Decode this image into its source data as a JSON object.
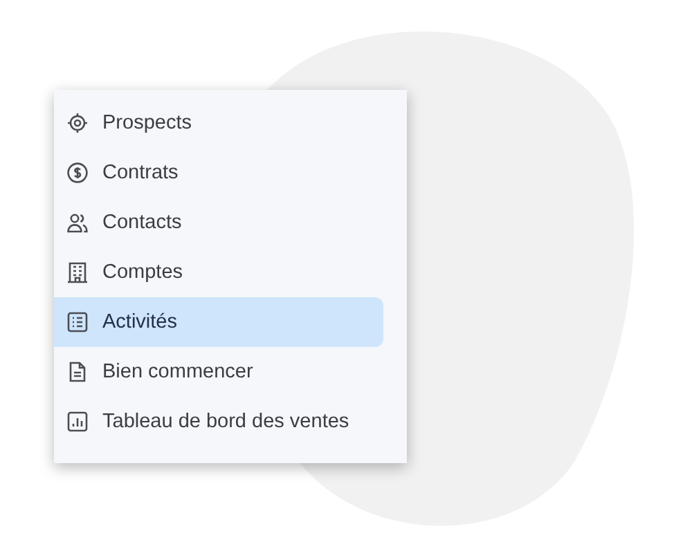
{
  "menu": {
    "items": [
      {
        "label": "Prospects",
        "selected": false
      },
      {
        "label": "Contrats",
        "selected": false
      },
      {
        "label": "Contacts",
        "selected": false
      },
      {
        "label": "Comptes",
        "selected": false
      },
      {
        "label": "Activités",
        "selected": true
      },
      {
        "label": "Bien commencer",
        "selected": false
      },
      {
        "label": "Tableau de bord des ventes",
        "selected": false
      }
    ]
  }
}
